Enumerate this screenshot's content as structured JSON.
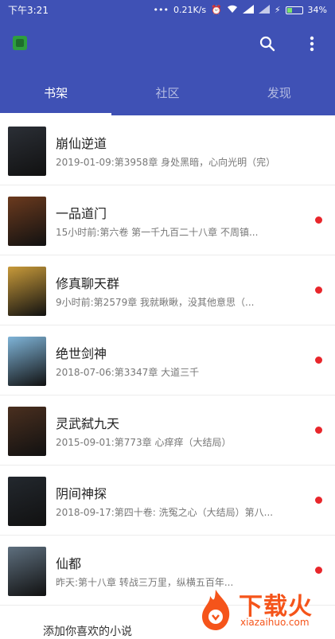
{
  "status_bar": {
    "time": "下午3:21",
    "dots": "•••",
    "speed": "0.21K/s",
    "battery": "34%",
    "battery_level": 0.34
  },
  "app": {
    "colors": {
      "primary": "#3f51b5",
      "unread": "#e8262b"
    },
    "tabs": [
      {
        "label": "书架",
        "active": true
      },
      {
        "label": "社区",
        "active": false
      },
      {
        "label": "发现",
        "active": false
      }
    ]
  },
  "books": [
    {
      "title": "崩仙逆道",
      "subtitle": "2019-01-09:第3958章  身处黑暗，心向光明（完）",
      "unread": false,
      "cover_color": "#2b2f36"
    },
    {
      "title": "一品道门",
      "subtitle": "15小时前:第六卷 第一千九百二十八章 不周镇...",
      "unread": true,
      "cover_color": "#6b3a1e"
    },
    {
      "title": "修真聊天群",
      "subtitle": "9小时前:第2579章 我就瞅瞅，没其他意思（...",
      "unread": true,
      "cover_color": "#c89a3a"
    },
    {
      "title": "绝世剑神",
      "subtitle": "2018-07-06:第3347章    大道三千",
      "unread": true,
      "cover_color": "#7fb4d8"
    },
    {
      "title": "灵武弑九天",
      "subtitle": "2015-09-01:第773章 心痒痒（大结局）",
      "unread": true,
      "cover_color": "#4a2f1f"
    },
    {
      "title": "阴间神探",
      "subtitle": "2018-09-17:第四十卷: 洗冤之心（大结局）第八...",
      "unread": true,
      "cover_color": "#23282e"
    },
    {
      "title": "仙都",
      "subtitle": "昨天:第十八章 转战三万里，纵横五百年...",
      "unread": true,
      "cover_color": "#5e6f7e"
    }
  ],
  "add_prompt": "添加你喜欢的小说",
  "watermark": {
    "text": "下载火",
    "url": "xiazaihuo.com"
  }
}
